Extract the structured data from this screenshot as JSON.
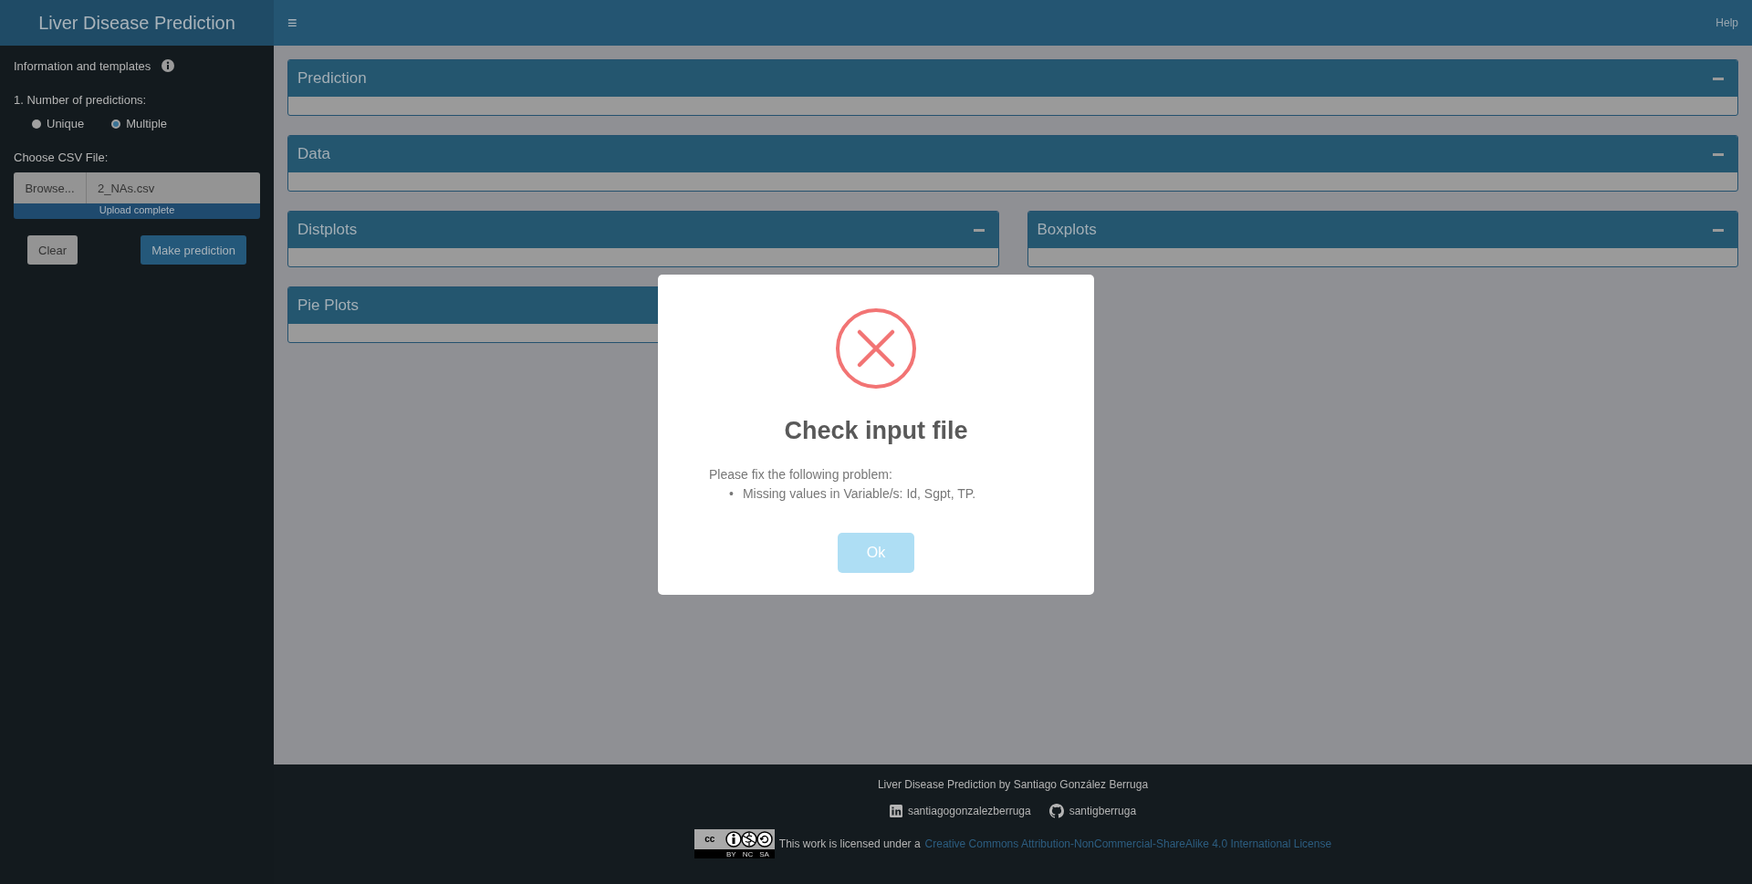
{
  "header": {
    "title": "Liver Disease Prediction",
    "menu_icon": "≡",
    "help": "Help"
  },
  "sidebar": {
    "info_label": "Information and templates",
    "radio_label": "1. Number of predictions:",
    "radio_options": [
      {
        "label": "Unique",
        "selected": false
      },
      {
        "label": "Multiple",
        "selected": true
      }
    ],
    "file_label": "Choose CSV File:",
    "browse_button": "Browse...",
    "file_name": "2_NAs.csv",
    "upload": {
      "status": "Upload complete",
      "level": 1
    },
    "buttons": [
      {
        "label": "Clear",
        "kind": "default"
      },
      {
        "label": "Make prediction",
        "kind": "primary"
      }
    ]
  },
  "panels": [
    {
      "title": "Prediction",
      "kind": "full",
      "collapse_icon": true
    },
    {
      "title": "Data",
      "kind": "full",
      "collapse_icon": true
    },
    {
      "title": "Distplots",
      "kind": "half",
      "collapse_icon": true
    },
    {
      "title": "Boxplots",
      "kind": "half",
      "collapse_icon": true
    },
    {
      "title": "Pie Plots",
      "kind": "half",
      "collapse_icon": false
    }
  ],
  "modal": {
    "kind": "error",
    "title": "Check input file",
    "message": "Please fix the following problem:",
    "bullet": "•",
    "problems": [
      "Missing values in Variable/s: Id, Sgpt, TP."
    ],
    "button": "Ok"
  },
  "footer": {
    "credit": "Liver Disease Prediction by Santiago González Berruga",
    "links": [
      {
        "kind": "linkedin",
        "label": "santiagogonzalezberruga"
      },
      {
        "kind": "github",
        "label": "santigberruga"
      }
    ],
    "badge": {
      "logo": "cc",
      "terms": [
        "BY",
        "NC",
        "SA"
      ]
    },
    "license_text": "This work is licensed under a",
    "license_link": "Creative Commons Attribution-NonCommercial-ShareAlike 4.0 International License"
  }
}
